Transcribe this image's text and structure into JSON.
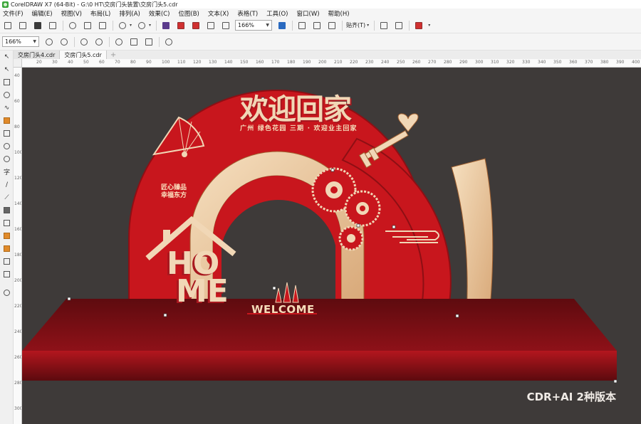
{
  "window": {
    "title": "CorelDRAW X7 (64-Bit) - G:\\0 HT\\交房门头装置\\交房门头5.cdr"
  },
  "menu": [
    {
      "label": "文件(F)"
    },
    {
      "label": "编辑(E)"
    },
    {
      "label": "视图(V)"
    },
    {
      "label": "布局(L)"
    },
    {
      "label": "排列(A)"
    },
    {
      "label": "效果(C)"
    },
    {
      "label": "位图(B)"
    },
    {
      "label": "文本(X)"
    },
    {
      "label": "表格(T)"
    },
    {
      "label": "工具(O)"
    },
    {
      "label": "窗口(W)"
    },
    {
      "label": "帮助(H)"
    }
  ],
  "toolbar": {
    "zoom_value": "166%",
    "snap_label": "贴齐(T)"
  },
  "property_bar": {
    "zoom_value": "166%"
  },
  "doc_tabs": [
    {
      "label": "交房门头4.cdr",
      "active": false
    },
    {
      "label": "交房门头5.cdr",
      "active": true
    }
  ],
  "ruler": {
    "h_labels": [
      "20",
      "30",
      "40",
      "50",
      "60",
      "70",
      "80",
      "90",
      "100",
      "110",
      "120",
      "130",
      "140",
      "150",
      "160",
      "170",
      "180",
      "190",
      "200",
      "210",
      "220",
      "230",
      "240",
      "250",
      "260",
      "270",
      "280",
      "290",
      "300",
      "310",
      "320",
      "330",
      "340",
      "350",
      "360",
      "370",
      "380",
      "390",
      "400"
    ],
    "v_labels": [
      "40",
      "60",
      "80",
      "100",
      "120",
      "140",
      "160",
      "180",
      "200",
      "220",
      "240",
      "260",
      "280",
      "300"
    ]
  },
  "artwork": {
    "heading": "欢迎回家",
    "subline": "广州 绿色花园 三期 · 欢迎业主回家",
    "slogan_line1": "匠心臻品",
    "slogan_line2": "幸福东方",
    "home_h": "HO",
    "home_me": "ME",
    "welcome": "WELCOME",
    "colors": {
      "red": "#c8161d",
      "dark_red": "#8e0f14",
      "gold": "#f1d7b6",
      "bg": "#3e3a39"
    }
  },
  "watermark": "CDR+AI 2种版本"
}
